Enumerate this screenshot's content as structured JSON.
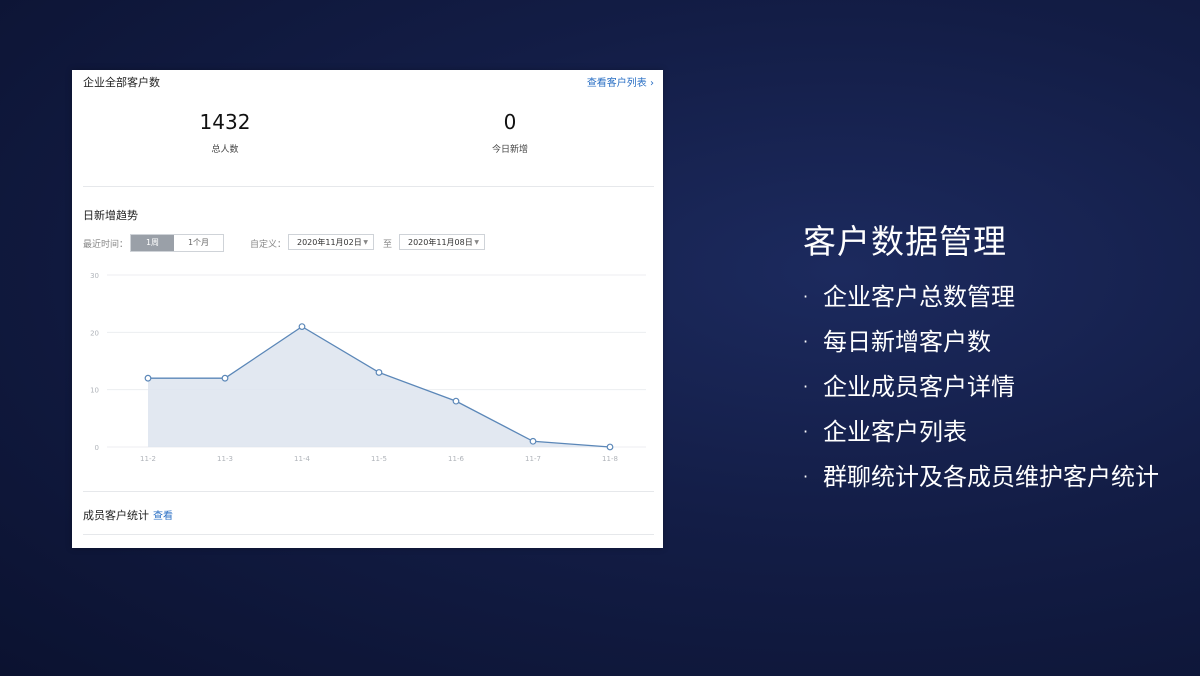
{
  "card": {
    "title": "企业全部客户数",
    "link": "查看客户列表 ›",
    "stats": [
      {
        "value": "1432",
        "label": "总人数"
      },
      {
        "value": "0",
        "label": "今日新增"
      }
    ],
    "trend_title": "日新增趋势",
    "filters": {
      "recent_label": "最近时间：",
      "seg_week": "1周",
      "seg_month": "1个月",
      "custom_label": "自定义：",
      "date_from": "2020年11月02日",
      "to_label": "至",
      "date_to": "2020年11月08日"
    },
    "member_title": "成员客户统计",
    "member_link": "查看"
  },
  "chart_data": {
    "type": "area",
    "categories": [
      "11-2",
      "11-3",
      "11-4",
      "11-5",
      "11-6",
      "11-7",
      "11-8"
    ],
    "values": [
      12,
      12,
      21,
      13,
      8,
      1,
      0
    ],
    "yticks": [
      0,
      10,
      20,
      30
    ],
    "ylim": [
      0,
      30
    ],
    "grid": true,
    "colors": {
      "line": "#5b87b8",
      "fill": "#dde4ef"
    }
  },
  "right": {
    "title": "客户数据管理",
    "items": [
      "企业客户总数管理",
      "每日新增客户数",
      "企业成员客户详情",
      "企业客户列表",
      "群聊统计及各成员维护客户统计"
    ]
  }
}
